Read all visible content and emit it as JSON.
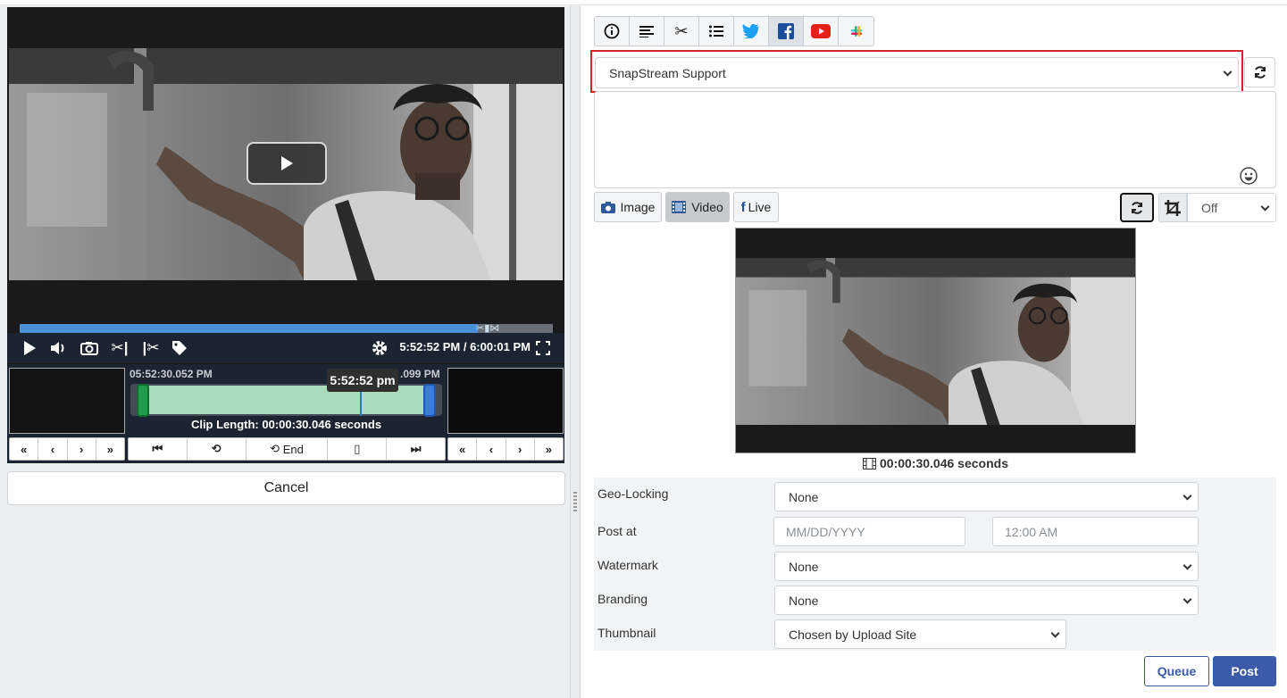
{
  "player": {
    "time_readout": "5:52:52 PM  / 6:00:01 PM",
    "progress_fraction": 0.86
  },
  "clip": {
    "start_timestamp": "05:52:30.052 PM",
    "end_timestamp_partial": ".099 PM",
    "tooltip": "5:52:52 pm",
    "clip_length": "Clip Length: 00:00:30.046 seconds",
    "end_label": "End"
  },
  "cancel_label": "Cancel",
  "tabs": [
    {
      "icon": "info-icon"
    },
    {
      "icon": "text-align-icon"
    },
    {
      "icon": "scissors-icon"
    },
    {
      "icon": "list-icon"
    },
    {
      "icon": "twitter-icon",
      "color": "#1da1f2"
    },
    {
      "icon": "facebook-icon",
      "color": "#1b4f9c",
      "active": true
    },
    {
      "icon": "youtube-icon",
      "color": "#e62117"
    },
    {
      "icon": "slack-icon"
    }
  ],
  "account": {
    "selected": "SnapStream Support"
  },
  "media_buttons": {
    "image": "Image",
    "video": "Video",
    "live": "Live"
  },
  "crop": {
    "selected": "Off"
  },
  "preview": {
    "duration": "00:00:30.046 seconds"
  },
  "form": {
    "geo_label": "Geo-Locking",
    "geo_value": "None",
    "post_at_label": "Post at",
    "date_placeholder": "MM/DD/YYYY",
    "time_placeholder": "12:00 AM",
    "watermark_label": "Watermark",
    "watermark_value": "None",
    "branding_label": "Branding",
    "branding_value": "None",
    "thumbnail_label": "Thumbnail",
    "thumbnail_value": "Chosen by Upload Site"
  },
  "actions": {
    "queue": "Queue",
    "post": "Post"
  },
  "colors": {
    "accent": "#3b5aa8",
    "highlight_border": "#d4252b"
  }
}
